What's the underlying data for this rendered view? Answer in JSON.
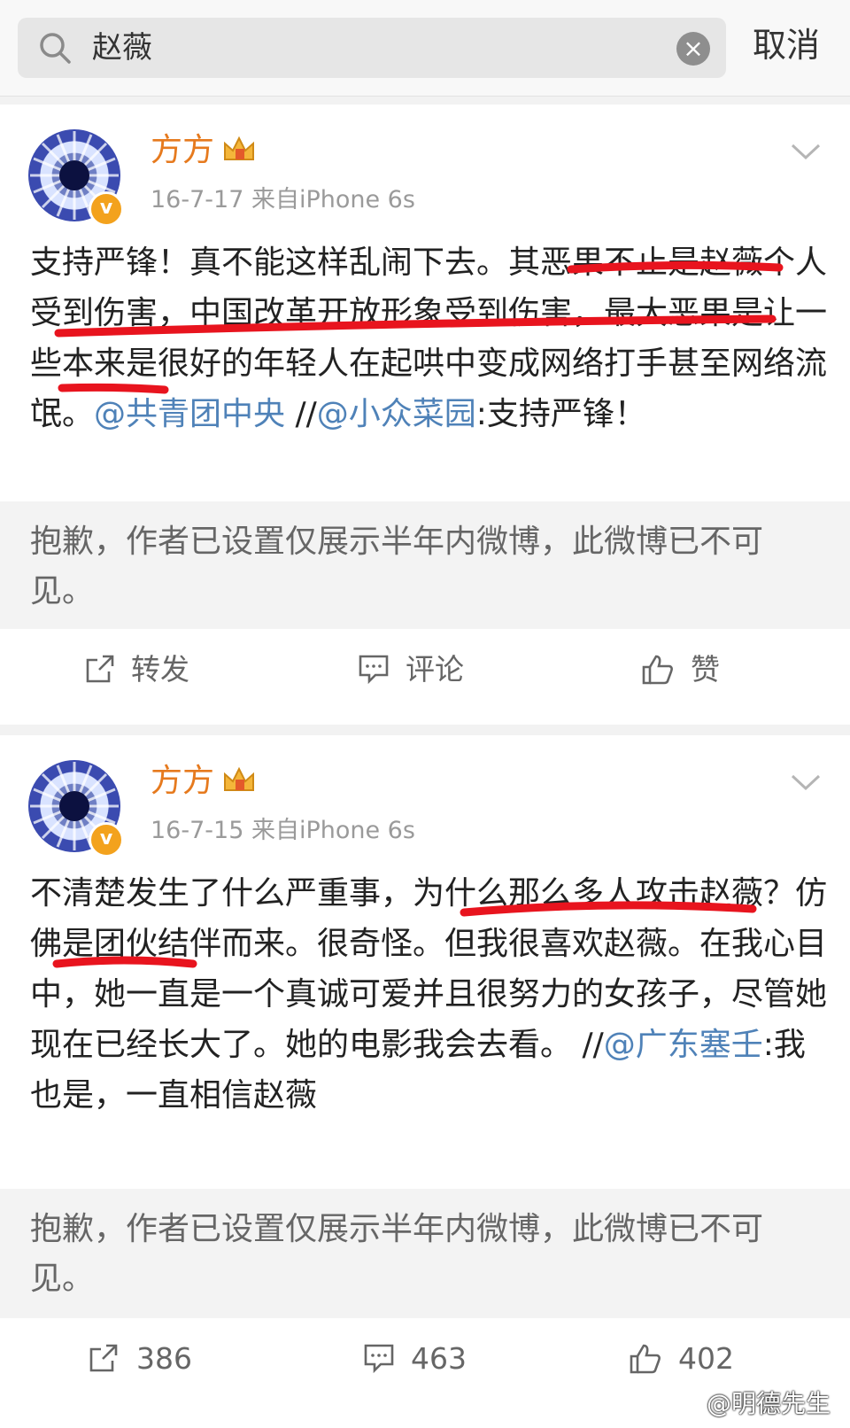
{
  "search": {
    "query": "赵薇",
    "cancel_label": "取消"
  },
  "posts": [
    {
      "username": "方方",
      "meta": "16-7-17  来自iPhone 6s",
      "text_parts": [
        "支持严锋！真不能这样乱闹下去。其恶果不止是赵薇个人受到伤害，中国改革开放形象受到伤害，最大恶果是让一些本来是很好的年轻人在起哄中变成网络打手甚至网络流氓。",
        "@共青团中央",
        "  //",
        "@小众菜园",
        ":支持严锋！"
      ],
      "retweet_notice": "抱歉，作者已设置仅展示半年内微博，此微博已不可见。",
      "actions": {
        "repost": "转发",
        "comment": "评论",
        "like": "赞"
      }
    },
    {
      "username": "方方",
      "meta": "16-7-15  来自iPhone 6s",
      "text_parts": [
        "不清楚发生了什么严重事，为什么那么多人攻击赵薇？仿佛是团伙结伴而来。很奇怪。但我很喜欢赵薇。在我心目中，她一直是一个真诚可爱并且很努力的女孩子，尽管她现在已经长大了。她的电影我会去看。 //",
        "@广东塞壬",
        ":我也是，一直相信赵薇"
      ],
      "retweet_notice": "抱歉，作者已设置仅展示半年内微博，此微博已不可见。",
      "actions": {
        "repost": "386",
        "comment": "463",
        "like": "402"
      }
    }
  ],
  "watermark": "@明德先生",
  "colors": {
    "username": "#e67a1e",
    "mention": "#4f82b8",
    "annotation": "#e8141e",
    "verified": "#f3a21d"
  }
}
